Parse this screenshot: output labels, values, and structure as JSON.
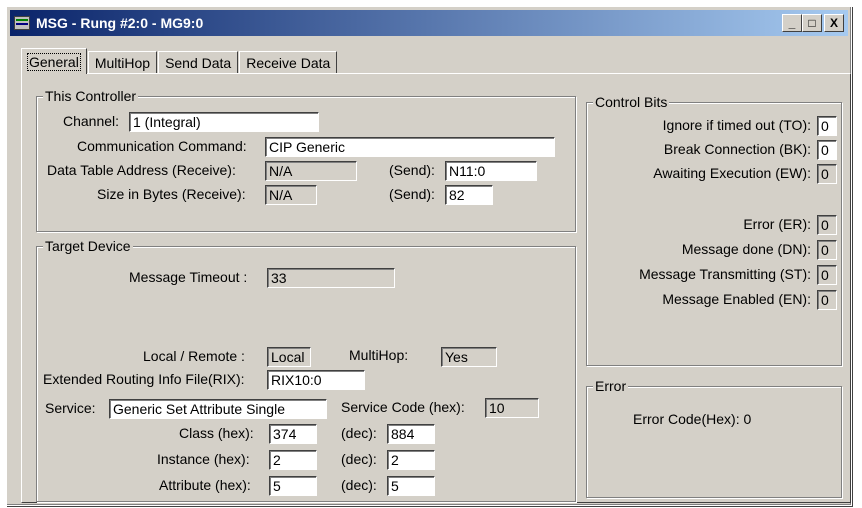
{
  "window": {
    "title": "MSG - Rung #2:0 - MG9:0",
    "btn_min": "_",
    "btn_max": "□",
    "btn_close": "X"
  },
  "tabs": [
    "General",
    "MultiHop",
    "Send Data",
    "Receive Data"
  ],
  "this_controller": {
    "legend": "This Controller",
    "channel_label": "Channel:",
    "channel_value": "1 (Integral)",
    "comm_label": "Communication Command:",
    "comm_value": "CIP Generic",
    "dta_label": "Data Table Address (Receive):",
    "dta_receive": "N/A",
    "send_label": "(Send):",
    "dta_send": "N11:0",
    "size_label": "Size in Bytes (Receive):",
    "size_receive": "N/A",
    "size_send": "82"
  },
  "target_device": {
    "legend": "Target Device",
    "timeout_label": "Message Timeout :",
    "timeout_value": "33",
    "local_label": "Local / Remote :",
    "local_value": "Local",
    "multihop_label": "MultiHop:",
    "multihop_value": "Yes",
    "rix_label": "Extended Routing Info File(RIX):",
    "rix_value": "RIX10:0",
    "service_label": "Service:",
    "service_value": "Generic Set Attribute Single",
    "service_code_label": "Service Code (hex):",
    "service_code_value": "10",
    "class_label": "Class (hex):",
    "class_hex": "374",
    "class_dec": "884",
    "instance_label": "Instance (hex):",
    "instance_hex": "2",
    "instance_dec": "2",
    "attribute_label": "Attribute (hex):",
    "attribute_hex": "5",
    "attribute_dec": "5",
    "dec_label": "(dec):"
  },
  "control_bits": {
    "legend": "Control Bits",
    "to_label": "Ignore if timed out (TO):",
    "to_value": "0",
    "bk_label": "Break Connection (BK):",
    "bk_value": "0",
    "ew_label": "Awaiting Execution (EW):",
    "ew_value": "0",
    "er_label": "Error (ER):",
    "er_value": "0",
    "dn_label": "Message done (DN):",
    "dn_value": "0",
    "st_label": "Message Transmitting (ST):",
    "st_value": "0",
    "en_label": "Message Enabled (EN):",
    "en_value": "0"
  },
  "error": {
    "legend": "Error",
    "code_label": "Error Code(Hex): 0"
  }
}
